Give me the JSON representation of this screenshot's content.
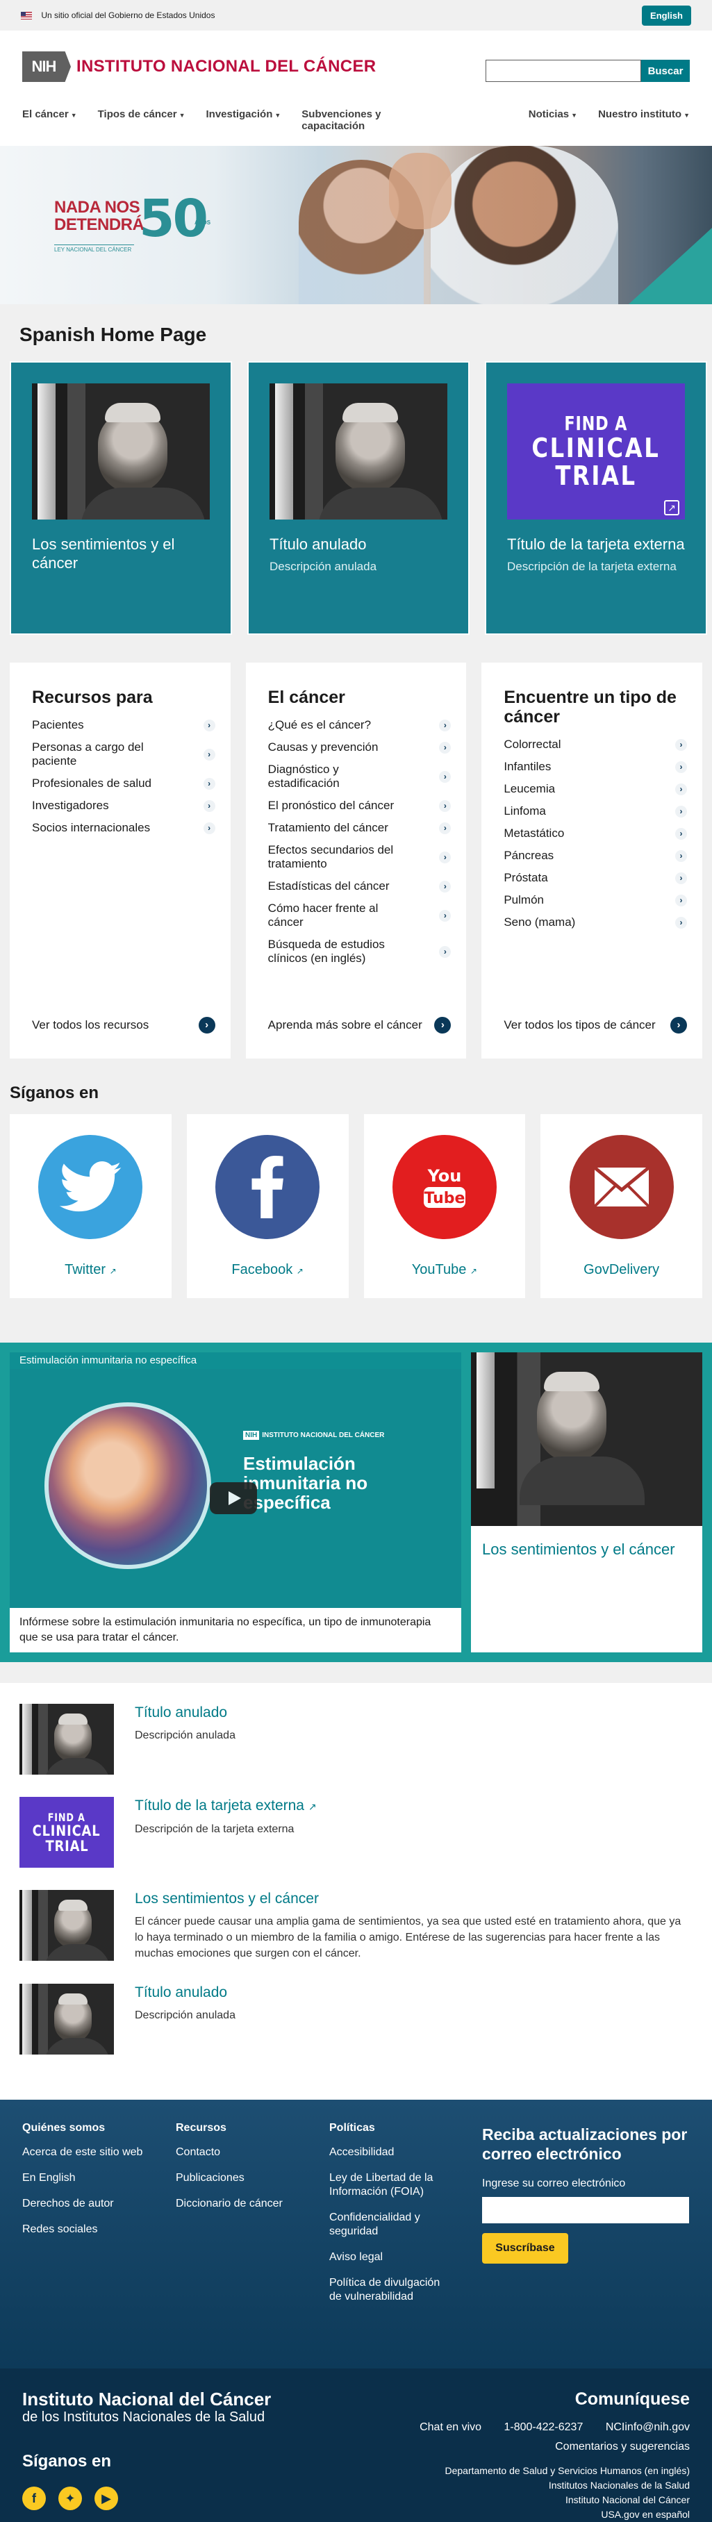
{
  "gov_banner": {
    "text": "Un sitio oficial del Gobierno de Estados Unidos",
    "lang_button": "English"
  },
  "header": {
    "logo_badge": "NIH",
    "logo_text": "INSTITUTO NACIONAL DEL CÁNCER",
    "search": {
      "placeholder": "",
      "button": "Buscar"
    },
    "nav": [
      {
        "label": "El cáncer"
      },
      {
        "label": "Tipos de cáncer"
      },
      {
        "label": "Investigación"
      },
      {
        "label": "Subvenciones y capacitación"
      },
      {
        "label": "Noticias"
      },
      {
        "label": "Nuestro instituto"
      }
    ]
  },
  "hero": {
    "title_line1": "NADA NOS",
    "title_line2": "DETENDRÁ",
    "number": "50",
    "anios": "AÑOS",
    "subtitle": "LEY NACIONAL DEL CÁNCER"
  },
  "page_title": "Spanish Home Page",
  "feature_cards": [
    {
      "title": "Los sentimientos y el cáncer",
      "description": "",
      "image": "elderly-man-window"
    },
    {
      "title": "Título anulado",
      "description": "Descripción anulada",
      "image": "elderly-man-window"
    },
    {
      "title": "Título de la tarjeta externa",
      "description": "Descripción de la tarjeta externa",
      "image": "find-a-clinical-trial",
      "image_text1": "FIND A",
      "image_text2": "CLINICAL",
      "image_text3": "TRIAL"
    }
  ],
  "lists": [
    {
      "title": "Recursos para",
      "items": [
        "Pacientes",
        "Personas a cargo del paciente",
        "Profesionales de salud",
        "Investigadores",
        "Socios internacionales"
      ],
      "footer": "Ver todos los recursos"
    },
    {
      "title": "El cáncer",
      "items": [
        "¿Qué es el cáncer?",
        "Causas y prevención",
        "Diagnóstico y estadificación",
        "El pronóstico del cáncer",
        "Tratamiento del cáncer",
        "Efectos secundarios del tratamiento",
        "Estadísticas del cáncer",
        "Cómo hacer frente al cáncer",
        "Búsqueda de estudios clínicos (en inglés)"
      ],
      "footer": "Aprenda más sobre el cáncer"
    },
    {
      "title": "Encuentre un tipo de cáncer",
      "items": [
        "Colorrectal",
        "Infantiles",
        "Leucemia",
        "Linfoma",
        "Metastático",
        "Páncreas",
        "Próstata",
        "Pulmón",
        "Seno (mama)"
      ],
      "footer": "Ver todos los tipos de cáncer"
    }
  ],
  "social": {
    "title": "Síganos en",
    "items": [
      {
        "label": "Twitter",
        "icon": "twitter-bird-icon",
        "color": "#3aa3de"
      },
      {
        "label": "Facebook",
        "icon": "facebook-f-icon",
        "color": "#3b5898"
      },
      {
        "label": "YouTube",
        "icon": "youtube-icon",
        "color": "#e21e1f"
      },
      {
        "label": "GovDelivery",
        "icon": "envelope-icon",
        "color": "#a8312c"
      }
    ]
  },
  "media": {
    "video_header": "Estimulación inmunitaria no específica",
    "video_logo": "INSTITUTO NACIONAL DEL CÁNCER",
    "video_title": "Estimulación inmunitaria no específica",
    "video_description": "Infórmese sobre la estimulación inmunitaria no específica, un tipo de inmunoterapia que se usa para tratar el cáncer.",
    "side_title": "Los sentimientos y el cáncer"
  },
  "teasers": [
    {
      "title": "Título anulado",
      "description": "Descripción anulada",
      "image": "elderly-man-window"
    },
    {
      "title": "Título de la tarjeta externa",
      "description": "Descripción de la tarjeta externa",
      "image": "find-a-clinical-trial"
    },
    {
      "title": "Los sentimientos y el cáncer",
      "description": "El cáncer puede causar una amplia gama de sentimientos, ya sea que usted esté en tratamiento ahora, que ya lo haya terminado o un miembro de la familia o amigo. Entérese de las sugerencias para hacer frente a las muchas emociones que surgen con el cáncer.",
      "image": "elderly-man-window"
    },
    {
      "title": "Título anulado",
      "description": "Descripción anulada",
      "image": "elderly-man-window"
    }
  ],
  "footer": {
    "columns": [
      {
        "title": "Quiénes somos",
        "links": [
          "Acerca de este sitio web",
          "En English",
          "Derechos de autor",
          "Redes sociales"
        ]
      },
      {
        "title": "Recursos",
        "links": [
          "Contacto",
          "Publicaciones",
          "Diccionario de cáncer"
        ]
      },
      {
        "title": "Políticas",
        "links": [
          "Accesibilidad",
          "Ley de Libertad de la Información (FOIA)",
          "Confidencialidad y seguridad",
          "Aviso legal",
          "Política de divulgación de vulnerabilidad"
        ]
      }
    ],
    "subscribe": {
      "title": "Reciba actualizaciones por correo electrónico",
      "label": "Ingrese su correo electrónico",
      "button": "Suscríbase"
    },
    "institute": "Instituto Nacional del Cáncer",
    "institute_sub": "de los Institutos Nacionales de la Salud",
    "follow": "Síganos en",
    "contact": {
      "title": "Comuníquese",
      "chat": "Chat en vivo",
      "phone": "1-800-422-6237",
      "email": "NCIinfo@nih.gov",
      "feedback": "Comentarios y sugerencias",
      "links": [
        "Departamento de Salud y Servicios Humanos (en inglés)",
        "Institutos Nacionales de la Salud",
        "Instituto Nacional del Cáncer",
        "USA.gov en español"
      ]
    }
  }
}
